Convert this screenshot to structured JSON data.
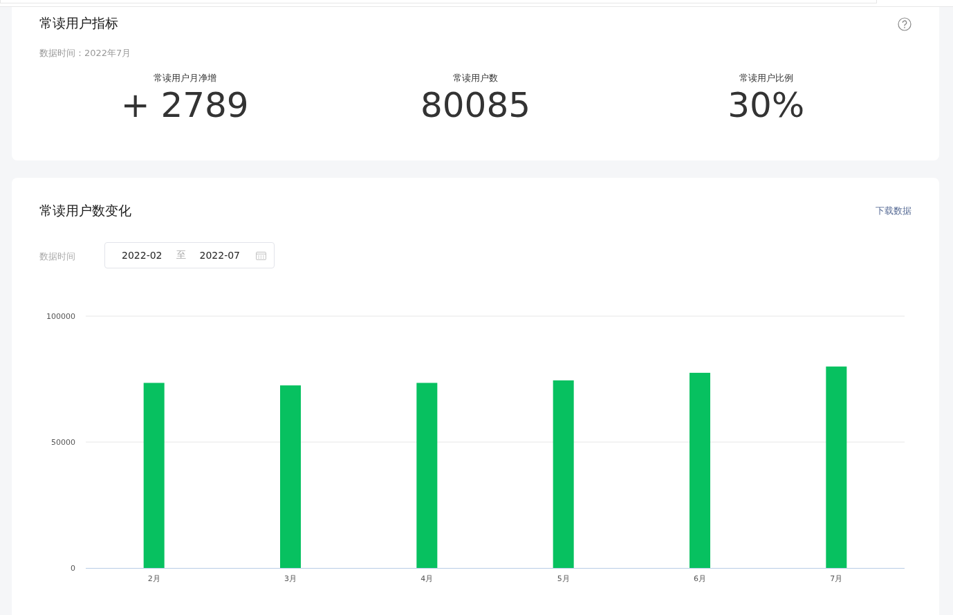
{
  "metrics_card": {
    "title": "常读用户指标",
    "data_time": "数据时间：2022年7月",
    "metrics": [
      {
        "label": "常读用户月净增",
        "value": "+ 2789"
      },
      {
        "label": "常读用户数",
        "value": "80085"
      },
      {
        "label": "常读用户比例",
        "value": "30%"
      }
    ]
  },
  "trend_card": {
    "title": "常读用户数变化",
    "download_link": "下载数据",
    "date_label": "数据时间",
    "date_range": {
      "start": "2022-02",
      "separator": "至",
      "end": "2022-07"
    },
    "chart_data": {
      "type": "bar",
      "categories": [
        "2月",
        "3月",
        "4月",
        "5月",
        "6月",
        "7月"
      ],
      "values": [
        73500,
        72500,
        73500,
        74500,
        77500,
        80000
      ],
      "ylim": [
        0,
        100000
      ],
      "yticks": [
        0,
        50000,
        100000
      ]
    }
  }
}
